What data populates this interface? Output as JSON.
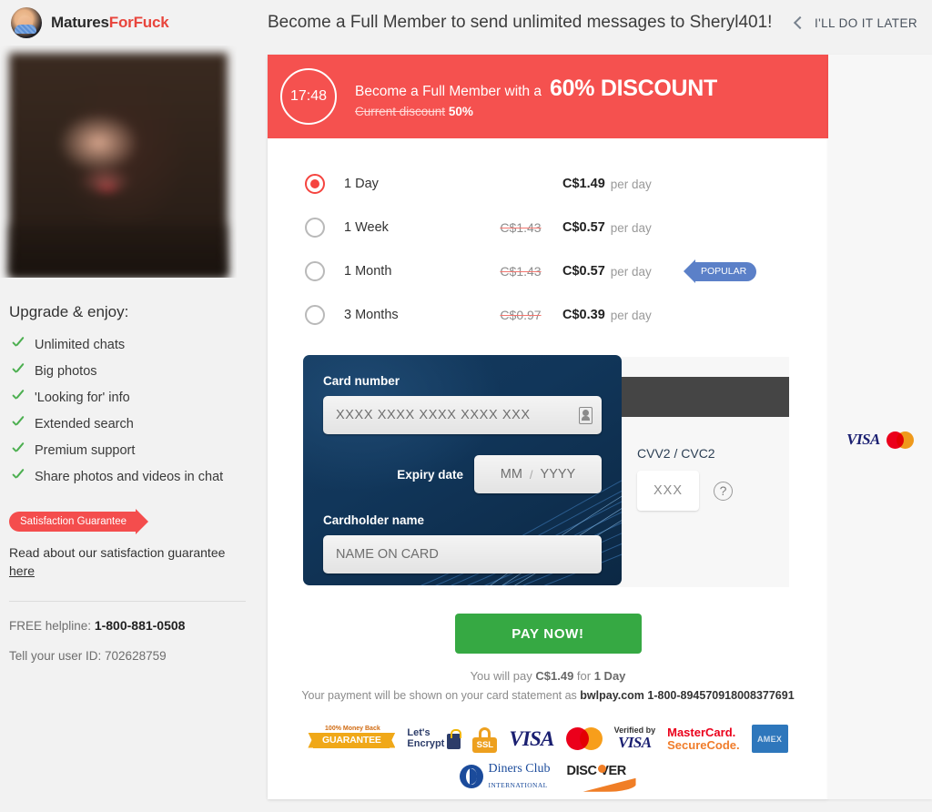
{
  "brand": {
    "name_part1": "Matures",
    "name_part2": "ForFuck",
    "logo_icon": "torso-logo-icon"
  },
  "header": {
    "title": "Become a Full Member to send unlimited messages to Sheryl401!",
    "later_label": "I'LL DO IT LATER",
    "back_icon": "chevron-left-icon"
  },
  "sidebar": {
    "photo_alt": "blurred-profile-photo",
    "benefits_title": "Upgrade & enjoy:",
    "benefits": [
      {
        "label": "Unlimited chats"
      },
      {
        "label": "Big photos"
      },
      {
        "label": "'Looking for' info"
      },
      {
        "label": "Extended search"
      },
      {
        "label": "Premium support"
      },
      {
        "label": "Share photos and videos in chat"
      }
    ],
    "guarantee_badge": "Satisfaction Guarantee",
    "guarantee_text": "Read about our satisfaction guarantee",
    "guarantee_link": "here",
    "helpline_label": "FREE helpline:",
    "helpline_number": "1-800-881-0508",
    "user_id_text": "Tell your user ID: 702628759"
  },
  "banner": {
    "timer": "17:48",
    "line1_prefix": "Become a Full Member with a",
    "line1_discount": "60% DISCOUNT",
    "line2_strike": "Current discount",
    "line2_value": "50%",
    "color": "#f5514f"
  },
  "plans": [
    {
      "name": "1 Day",
      "old_price": "",
      "new_price": "C$1.49",
      "per": "per day",
      "selected": true,
      "badge": ""
    },
    {
      "name": "1 Week",
      "old_price": "C$1.43",
      "new_price": "C$0.57",
      "per": "per day",
      "selected": false,
      "badge": ""
    },
    {
      "name": "1 Month",
      "old_price": "C$1.43",
      "new_price": "C$0.57",
      "per": "per day",
      "selected": false,
      "badge": "POPULAR"
    },
    {
      "name": "3 Months",
      "old_price": "C$0.97",
      "new_price": "C$0.39",
      "per": "per day",
      "selected": false,
      "badge": ""
    }
  ],
  "card_form": {
    "number_label": "Card number",
    "number_placeholder": "XXXX XXXX XXXX XXXX XXX",
    "scan_icon": "card-scan-icon",
    "expiry_label": "Expiry date",
    "expiry_month_placeholder": "MM",
    "expiry_separator": "/",
    "expiry_year_placeholder": "YYYY",
    "name_label": "Cardholder name",
    "name_placeholder": "NAME ON CARD",
    "cvv_label": "CVV2 / CVC2",
    "cvv_placeholder": "XXX",
    "cvv_help_icon": "question-mark-icon"
  },
  "payment": {
    "button_label": "PAY NOW!",
    "note_prefix": "You will pay",
    "note_amount": "C$1.49",
    "note_middle": "for",
    "note_plan": "1 Day",
    "descriptor_prefix": "Your payment will be shown on your card statement as",
    "descriptor_value": "bwlpay.com 1-800-894570918008377691"
  },
  "side_panel": {
    "visa": "VISA",
    "mastercard_icon": "mastercard-icon"
  },
  "trust_badges": {
    "row1": [
      {
        "name": "money-back-guarantee-badge",
        "top": "100% Money Back",
        "main": "GUARANTEE"
      },
      {
        "name": "lets-encrypt-badge",
        "line1": "Let's",
        "line2": "Encrypt"
      },
      {
        "name": "ssl-badge",
        "label": "SSL"
      },
      {
        "name": "visa-badge",
        "label": "VISA"
      },
      {
        "name": "mastercard-badge",
        "label": ""
      },
      {
        "name": "verified-by-visa-badge",
        "top": "Verified by",
        "main": "VISA"
      },
      {
        "name": "mastercard-securecode-badge",
        "line1": "MasterCard.",
        "line2": "SecureCode."
      },
      {
        "name": "amex-badge",
        "label": "AMEX"
      }
    ],
    "row2": [
      {
        "name": "diners-club-badge",
        "line1": "Diners Club",
        "line2": "INTERNATIONAL"
      },
      {
        "name": "discover-badge",
        "label": "DISC VER"
      }
    ]
  }
}
